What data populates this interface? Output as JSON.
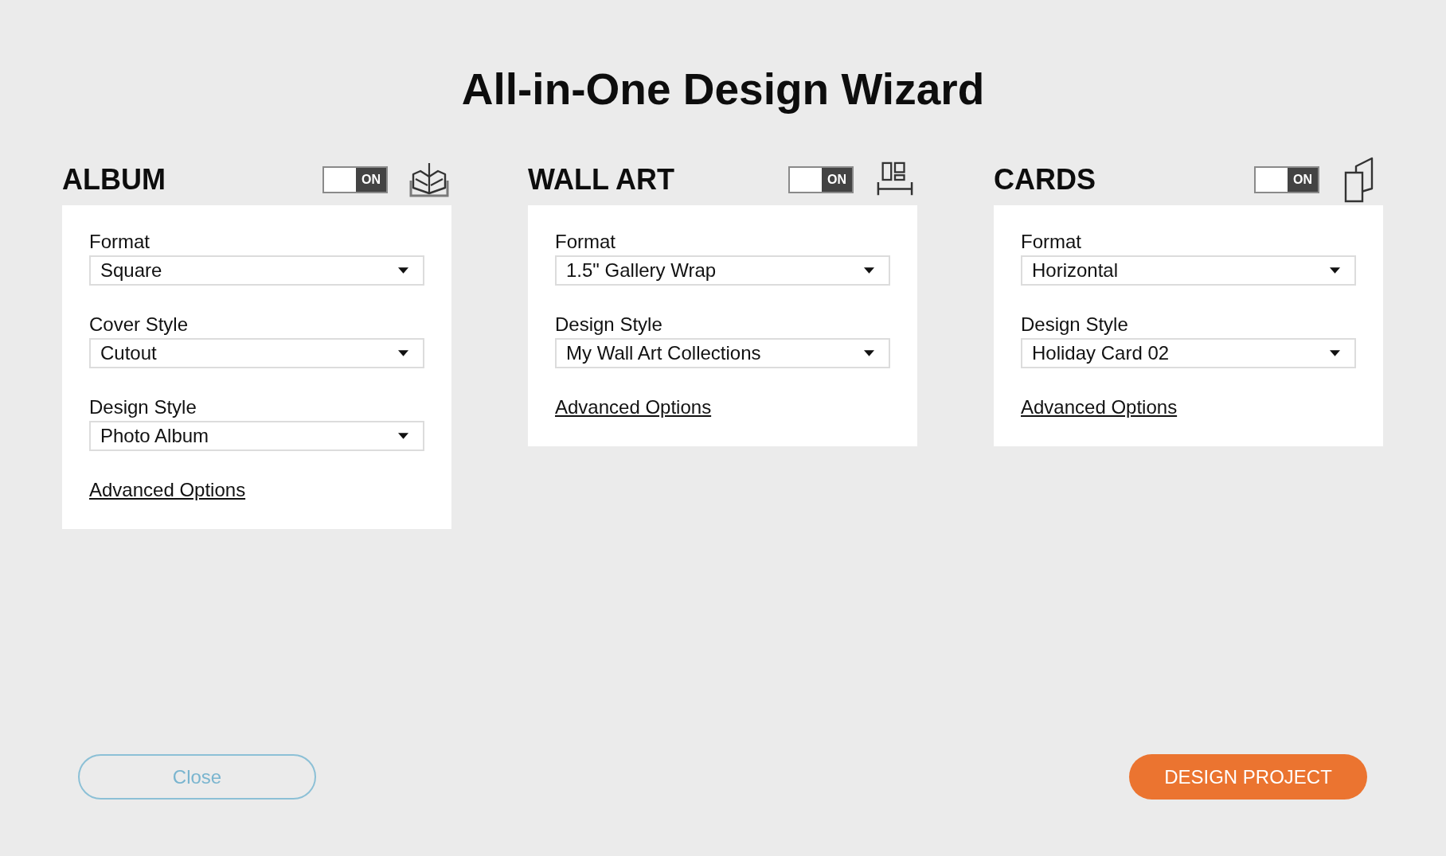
{
  "title": "All-in-One Design Wizard",
  "sections": [
    {
      "kind": "album",
      "heading": "ALBUM",
      "toggle": {
        "label": "ON",
        "on": true
      },
      "fields": [
        {
          "label": "Format",
          "value": "Square"
        },
        {
          "label": "Cover Style",
          "value": "Cutout"
        },
        {
          "label": "Design Style",
          "value": "Photo Album"
        }
      ],
      "link": "Advanced Options"
    },
    {
      "kind": "wall_art",
      "heading": "WALL ART",
      "toggle": {
        "label": "ON",
        "on": true
      },
      "fields": [
        {
          "label": "Format",
          "value": "1.5\" Gallery Wrap"
        },
        {
          "label": "Design Style",
          "value": "My Wall Art Collections"
        }
      ],
      "link": "Advanced Options"
    },
    {
      "kind": "cards",
      "heading": "CARDS",
      "toggle": {
        "label": "ON",
        "on": true
      },
      "fields": [
        {
          "label": "Format",
          "value": "Horizontal"
        },
        {
          "label": "Design Style",
          "value": "Holiday Card 02"
        }
      ],
      "link": "Advanced Options"
    }
  ],
  "buttons": [
    {
      "kind": "secondary",
      "label": "Close"
    },
    {
      "kind": "primary",
      "label": "DESIGN PROJECT"
    }
  ]
}
